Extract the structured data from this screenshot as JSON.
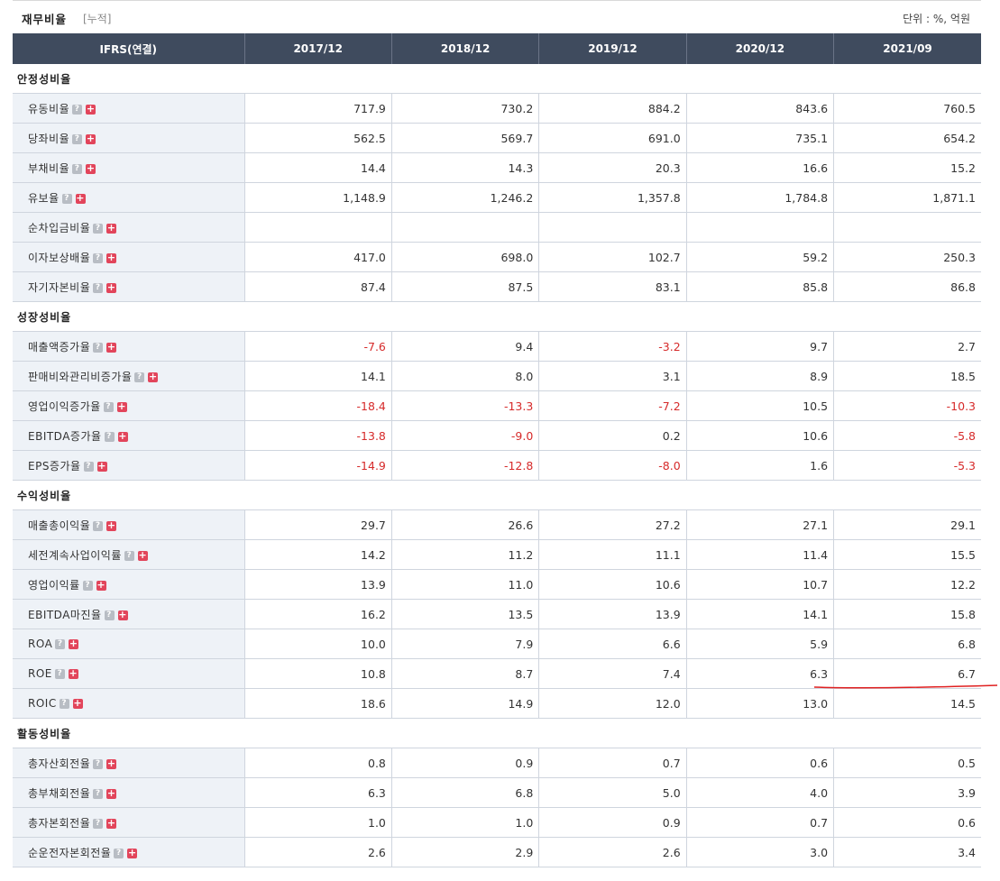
{
  "header": {
    "title": "재무비율",
    "subtitle": "[누적]",
    "unit": "단위 : %, 억원"
  },
  "columns": [
    "IFRS(연결)",
    "2017/12",
    "2018/12",
    "2019/12",
    "2020/12",
    "2021/09"
  ],
  "sections": [
    {
      "title": "안정성비율",
      "rows": [
        {
          "label": "유동비율",
          "values": [
            "717.9",
            "730.2",
            "884.2",
            "843.6",
            "760.5"
          ]
        },
        {
          "label": "당좌비율",
          "values": [
            "562.5",
            "569.7",
            "691.0",
            "735.1",
            "654.2"
          ]
        },
        {
          "label": "부채비율",
          "values": [
            "14.4",
            "14.3",
            "20.3",
            "16.6",
            "15.2"
          ]
        },
        {
          "label": "유보율",
          "values": [
            "1,148.9",
            "1,246.2",
            "1,357.8",
            "1,784.8",
            "1,871.1"
          ]
        },
        {
          "label": "순차입금비율",
          "values": [
            "",
            "",
            "",
            "",
            ""
          ]
        },
        {
          "label": "이자보상배율",
          "values": [
            "417.0",
            "698.0",
            "102.7",
            "59.2",
            "250.3"
          ]
        },
        {
          "label": "자기자본비율",
          "values": [
            "87.4",
            "87.5",
            "83.1",
            "85.8",
            "86.8"
          ]
        }
      ]
    },
    {
      "title": "성장성비율",
      "rows": [
        {
          "label": "매출액증가율",
          "values": [
            "-7.6",
            "9.4",
            "-3.2",
            "9.7",
            "2.7"
          ]
        },
        {
          "label": "판매비와관리비증가율",
          "values": [
            "14.1",
            "8.0",
            "3.1",
            "8.9",
            "18.5"
          ]
        },
        {
          "label": "영업이익증가율",
          "values": [
            "-18.4",
            "-13.3",
            "-7.2",
            "10.5",
            "-10.3"
          ]
        },
        {
          "label": "EBITDA증가율",
          "values": [
            "-13.8",
            "-9.0",
            "0.2",
            "10.6",
            "-5.8"
          ]
        },
        {
          "label": "EPS증가율",
          "values": [
            "-14.9",
            "-12.8",
            "-8.0",
            "1.6",
            "-5.3"
          ]
        }
      ]
    },
    {
      "title": "수익성비율",
      "rows": [
        {
          "label": "매출총이익율",
          "values": [
            "29.7",
            "26.6",
            "27.2",
            "27.1",
            "29.1"
          ]
        },
        {
          "label": "세전계속사업이익률",
          "values": [
            "14.2",
            "11.2",
            "11.1",
            "11.4",
            "15.5"
          ]
        },
        {
          "label": "영업이익률",
          "values": [
            "13.9",
            "11.0",
            "10.6",
            "10.7",
            "12.2"
          ]
        },
        {
          "label": "EBITDA마진율",
          "values": [
            "16.2",
            "13.5",
            "13.9",
            "14.1",
            "15.8"
          ]
        },
        {
          "label": "ROA",
          "values": [
            "10.0",
            "7.9",
            "6.6",
            "5.9",
            "6.8"
          ]
        },
        {
          "label": "ROE",
          "values": [
            "10.8",
            "8.7",
            "7.4",
            "6.3",
            "6.7"
          ]
        },
        {
          "label": "ROIC",
          "values": [
            "18.6",
            "14.9",
            "12.0",
            "13.0",
            "14.5"
          ]
        }
      ]
    },
    {
      "title": "활동성비율",
      "rows": [
        {
          "label": "총자산회전율",
          "values": [
            "0.8",
            "0.9",
            "0.7",
            "0.6",
            "0.5"
          ]
        },
        {
          "label": "총부채회전율",
          "values": [
            "6.3",
            "6.8",
            "5.0",
            "4.0",
            "3.9"
          ]
        },
        {
          "label": "총자본회전율",
          "values": [
            "1.0",
            "1.0",
            "0.9",
            "0.7",
            "0.6"
          ]
        },
        {
          "label": "순운전자본회전율",
          "values": [
            "2.6",
            "2.9",
            "2.6",
            "3.0",
            "3.4"
          ]
        }
      ]
    }
  ],
  "icons": {
    "help": "?",
    "expand": "+"
  },
  "colors": {
    "header_bg": "#3f4b5e",
    "label_bg": "#eef2f7",
    "negative": "#d62a2a",
    "annotation": "#e02020"
  }
}
